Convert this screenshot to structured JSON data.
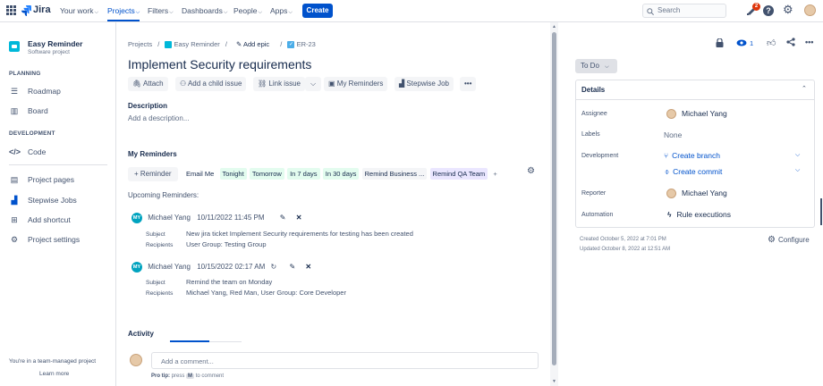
{
  "topnav": {
    "logo": "Jira",
    "items": [
      "Your work",
      "Projects",
      "Filters",
      "Dashboards",
      "People",
      "Apps"
    ],
    "create": "Create",
    "search_placeholder": "Search",
    "notif_count": "2"
  },
  "sidebar": {
    "project_name": "Easy Reminder",
    "project_type": "Software project",
    "planning_head": "PLANNING",
    "roadmap": "Roadmap",
    "board": "Board",
    "development_head": "DEVELOPMENT",
    "code": "Code",
    "project_pages": "Project pages",
    "stepwise_jobs": "Stepwise Jobs",
    "add_shortcut": "Add shortcut",
    "project_settings": "Project settings",
    "team_managed": "You're in a team-managed project",
    "learn_more": "Learn more"
  },
  "breadcrumb": {
    "projects": "Projects",
    "sep": "/",
    "project": "Easy Reminder",
    "add_epic": "Add epic",
    "issue_key": "ER-23"
  },
  "issue": {
    "title": "Implement Security requirements",
    "buttons": {
      "attach": "Attach",
      "add_child": "Add a child issue",
      "link_issue": "Link issue",
      "my_reminders": "My Reminders",
      "stepwise_job": "Stepwise Job",
      "more": "•••"
    },
    "description_label": "Description",
    "description_placeholder": "Add a description..."
  },
  "reminders": {
    "heading": "My Reminders",
    "add_button": "+ Reminder",
    "chips": [
      "Email Me",
      "Tonight",
      "Tomorrow",
      "In 7 days",
      "In 30 days",
      "Remind Business ...",
      "Remind QA Team",
      "+"
    ],
    "upcoming_heading": "Upcoming Reminders:",
    "subject_label": "Subject",
    "recipients_label": "Recipients",
    "items": [
      {
        "initials": "MY",
        "user": "Michael Yang",
        "datetime": "10/11/2022 11:45 PM",
        "subject": "New jira ticket Implement Security requirements for testing has been created",
        "recipients": "User Group: Testing Group"
      },
      {
        "initials": "MY",
        "user": "Michael Yang",
        "datetime": "10/15/2022 02:17 AM",
        "subject": "Remind the team on Monday",
        "recipients": "Michael Yang, Red Man, User Group: Core Developer"
      }
    ]
  },
  "activity": {
    "heading": "Activity",
    "comment_placeholder": "Add a comment...",
    "pro_tip_label": "Pro tip:",
    "pro_tip_press": "press",
    "pro_tip_key": "M",
    "pro_tip_rest": "to comment"
  },
  "right": {
    "watch_count": "1",
    "status": "To Do",
    "details_heading": "Details",
    "assignee_label": "Assignee",
    "assignee": "Michael Yang",
    "labels_label": "Labels",
    "labels_value": "None",
    "development_label": "Development",
    "create_branch": "Create branch",
    "create_commit": "Create commit",
    "reporter_label": "Reporter",
    "reporter": "Michael Yang",
    "automation_label": "Automation",
    "rule_executions": "Rule executions",
    "created": "Created October 5, 2022 at 7:01 PM",
    "updated": "Updated October 8, 2022 at 12:51 AM",
    "configure": "Configure"
  },
  "colors": {
    "brand": "#0052cc",
    "reminder_chip_bg": "#f4f5f7",
    "tonight_bg": "#e3fcef",
    "remind_qa_bg": "#eae6ff",
    "notif_badge": "#de350b"
  }
}
